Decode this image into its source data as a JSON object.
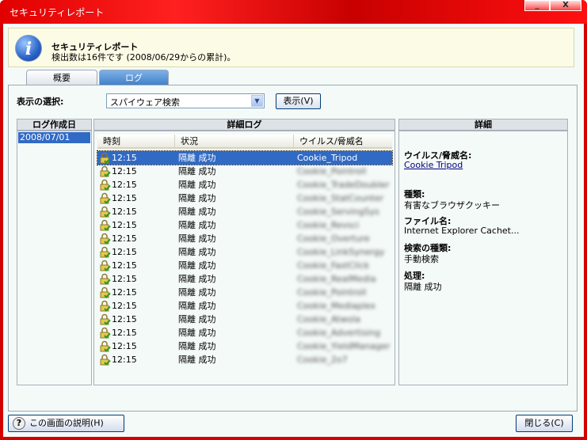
{
  "window": {
    "title": "セキュリティレポート",
    "minimize": "_",
    "close": "X"
  },
  "banner": {
    "title": "セキュリティレポート",
    "subtitle": "検出数は16件です (2008/06/29からの累計)。"
  },
  "tabs": [
    {
      "label": "概要"
    },
    {
      "label": "ログ"
    }
  ],
  "filter": {
    "label": "表示の選択:",
    "selected": "スパイウェア検索",
    "show_button": "表示(V)"
  },
  "left_panel": {
    "header": "ログ作成日",
    "dates": [
      "2008/07/01"
    ]
  },
  "log_panel": {
    "header": "詳細ログ",
    "columns": [
      "時刻",
      "状況",
      "ウイルス/脅威名"
    ],
    "rows": [
      {
        "time": "12:15",
        "status": "隔離 成功",
        "name": "Cookie_Tripod",
        "selected": true
      },
      {
        "time": "12:15",
        "status": "隔離 成功",
        "name": "Cookie_Pointroll"
      },
      {
        "time": "12:15",
        "status": "隔離 成功",
        "name": "Cookie_TradeDoubler"
      },
      {
        "time": "12:15",
        "status": "隔離 成功",
        "name": "Cookie_StatCounter"
      },
      {
        "time": "12:15",
        "status": "隔離 成功",
        "name": "Cookie_ServingSys"
      },
      {
        "time": "12:15",
        "status": "隔離 成功",
        "name": "Cookie_Revsci"
      },
      {
        "time": "12:15",
        "status": "隔離 成功",
        "name": "Cookie_Overture"
      },
      {
        "time": "12:15",
        "status": "隔離 成功",
        "name": "Cookie_LinkSynergy"
      },
      {
        "time": "12:15",
        "status": "隔離 成功",
        "name": "Cookie_FastClick"
      },
      {
        "time": "12:15",
        "status": "隔離 成功",
        "name": "Cookie_RealMedia"
      },
      {
        "time": "12:15",
        "status": "隔離 成功",
        "name": "Cookie_Pointroll"
      },
      {
        "time": "12:15",
        "status": "隔離 成功",
        "name": "Cookie_Mediaplex"
      },
      {
        "time": "12:15",
        "status": "隔離 成功",
        "name": "Cookie_Atwola"
      },
      {
        "time": "12:15",
        "status": "隔離 成功",
        "name": "Cookie_Advertising"
      },
      {
        "time": "12:15",
        "status": "隔離 成功",
        "name": "Cookie_YieldManager"
      },
      {
        "time": "12:15",
        "status": "隔離 成功",
        "name": "Cookie_2o7"
      }
    ]
  },
  "detail": {
    "header": "詳細",
    "threat_label": "ウイルス/脅威名:",
    "threat_value": "Cookie Tripod",
    "type_label": "種類:",
    "type_value": "有害なブラウザクッキー",
    "file_label": "ファイル名:",
    "file_value": "Internet Explorer Cachet...",
    "scan_label": "検索の種類:",
    "scan_value": "手動検索",
    "action_label": "処理:",
    "action_value": "隔離 成功"
  },
  "footer": {
    "help_button": "この画面の説明(H)",
    "close_button": "閉じる(C)"
  }
}
